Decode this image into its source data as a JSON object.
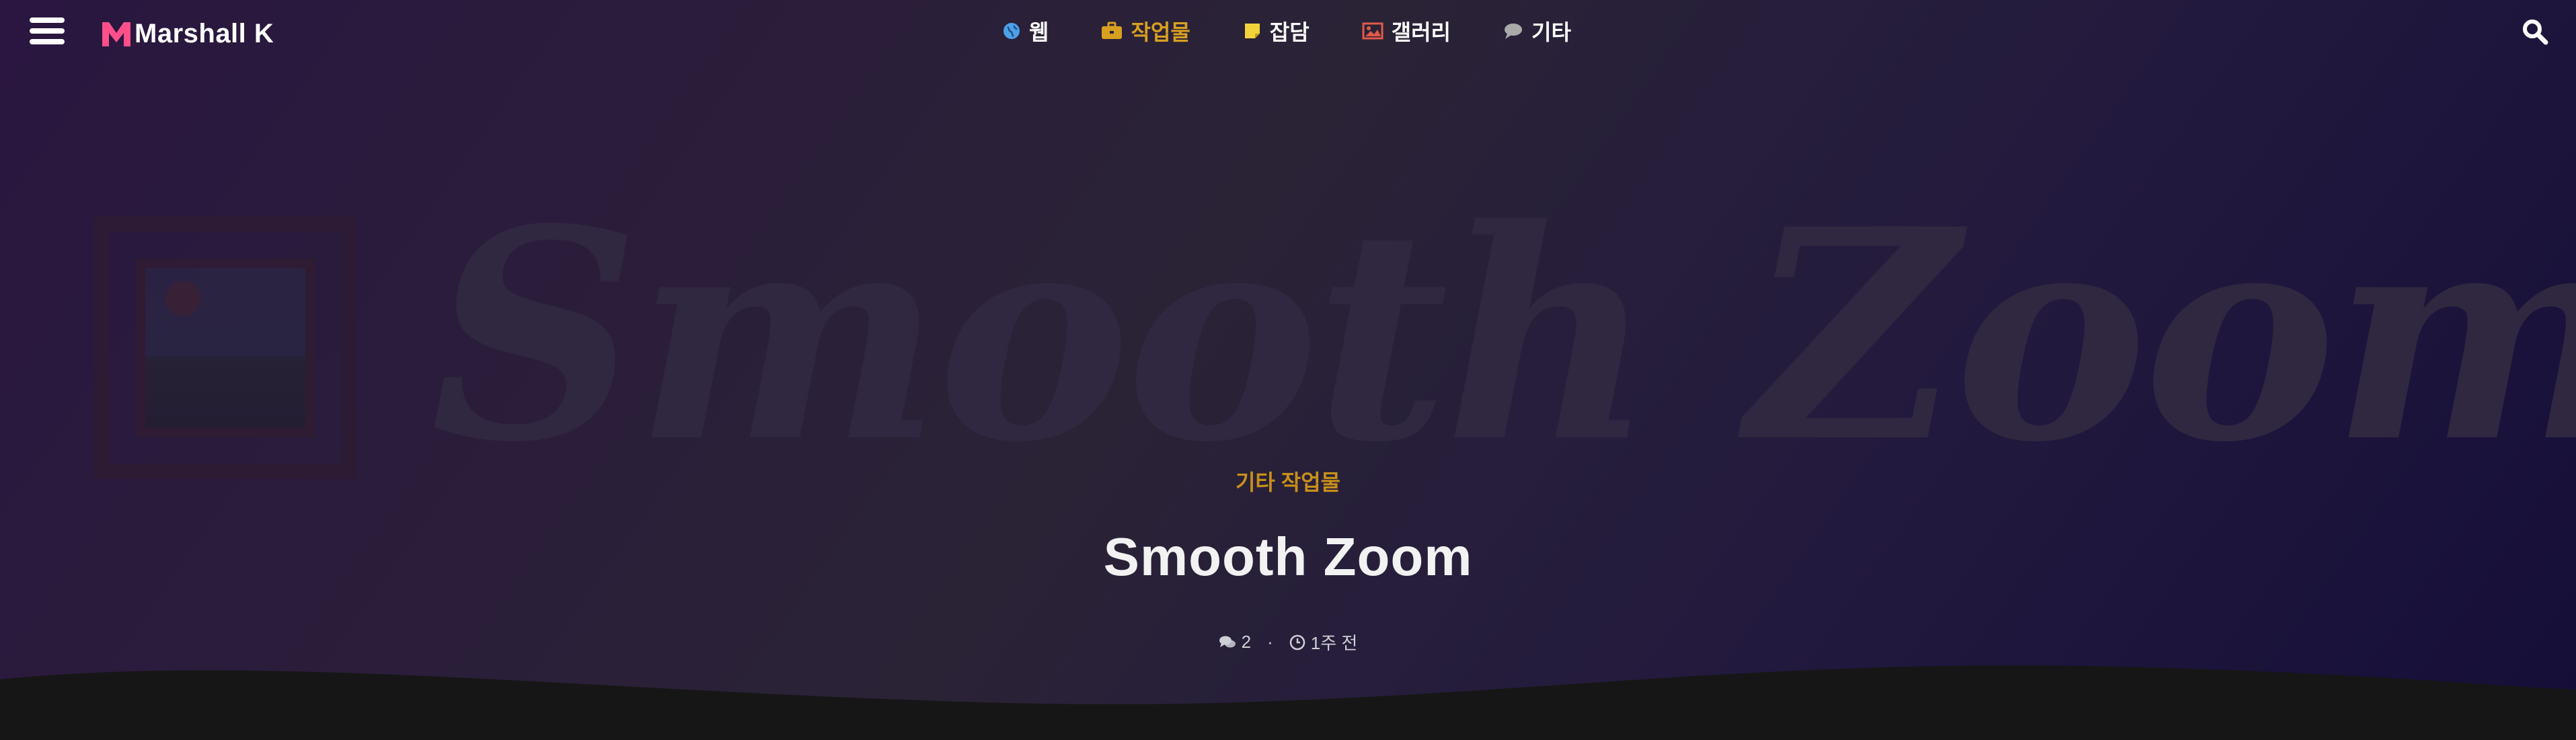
{
  "brand": {
    "name": "Marshall K",
    "logo_icon": "m-logo-icon",
    "accent": "#ff4f8b"
  },
  "nav": {
    "items": [
      {
        "label": "웹",
        "icon": "globe-icon",
        "icon_color": "#4ea0e8",
        "active": false
      },
      {
        "label": "작업물",
        "icon": "briefcase-icon",
        "icon_color": "#d8a020",
        "active": true
      },
      {
        "label": "잡담",
        "icon": "sticky-note-icon",
        "icon_color": "#f2d43a",
        "active": false
      },
      {
        "label": "갤러리",
        "icon": "image-icon",
        "icon_color": "#e05a4a",
        "active": false
      },
      {
        "label": "기타",
        "icon": "comment-icon",
        "icon_color": "#aaaaaa",
        "active": false
      }
    ]
  },
  "hero": {
    "background_text": "Smooth Zoom",
    "category": "기타 작업물",
    "title": "Smooth Zoom",
    "meta": {
      "comments": "2",
      "time": "1주 전"
    }
  },
  "colors": {
    "category": "#c8901a",
    "active_nav": "#d8a020"
  }
}
